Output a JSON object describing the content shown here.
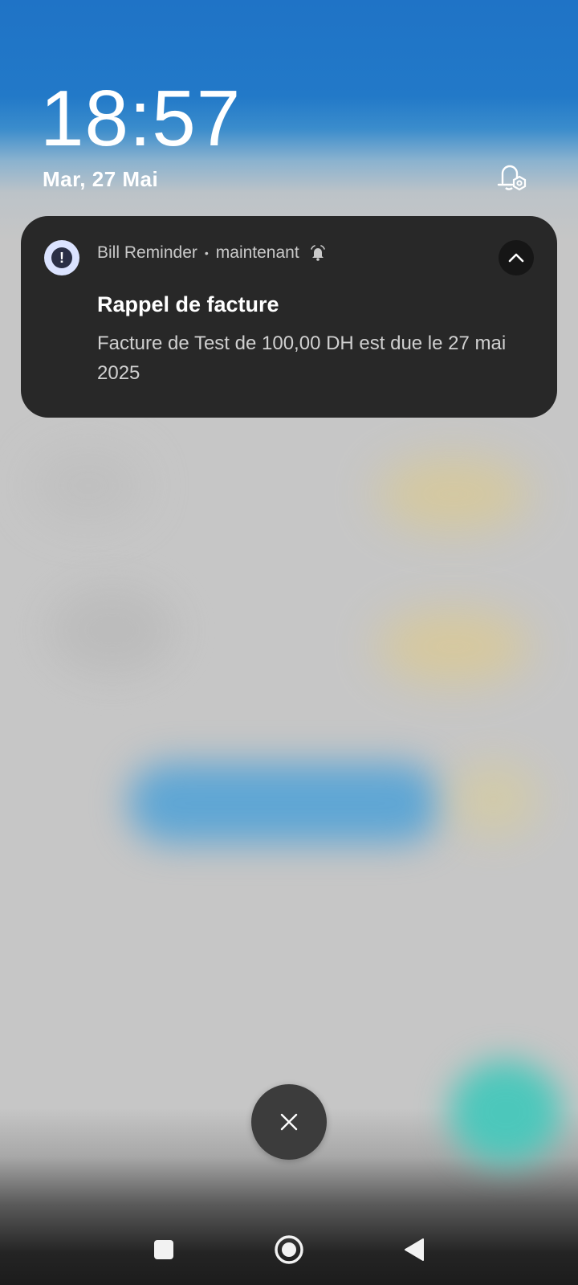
{
  "lockscreen": {
    "time": "18:57",
    "date": "Mar, 27 Mai"
  },
  "notification": {
    "app_name": "Bill Reminder",
    "separator": "•",
    "timestamp": "maintenant",
    "title": "Rappel de facture",
    "body": "Facture de Test de 100,00 DH est due le 27 mai 2025",
    "app_icon_glyph": "!"
  },
  "icons": {
    "settings": "notification-settings-icon",
    "bell": "alarm-bell-icon",
    "expand": "chevron-up-icon",
    "close": "close-icon",
    "nav_recents": "square-icon",
    "nav_home": "circle-icon",
    "nav_back": "triangle-back-icon"
  },
  "colors": {
    "top_blue": "#1f73c6",
    "card_bg": "#282828",
    "app_icon_bg": "#dbe3ff"
  }
}
